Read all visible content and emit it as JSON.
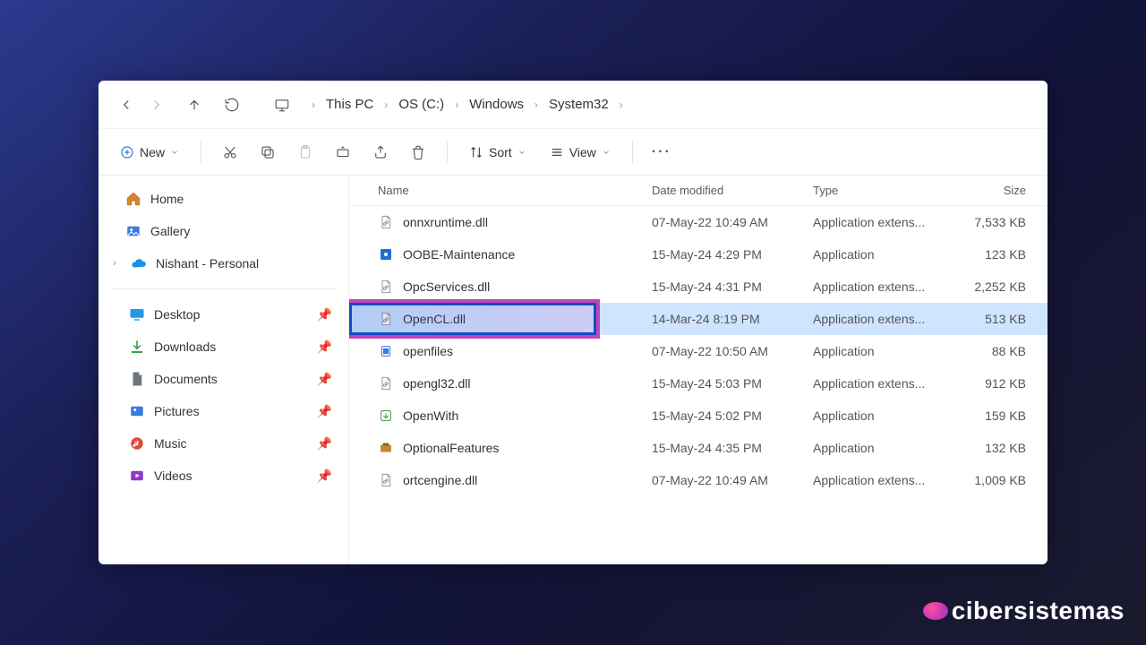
{
  "breadcrumbs": [
    "This PC",
    "OS (C:)",
    "Windows",
    "System32"
  ],
  "toolbar": {
    "new_label": "New",
    "sort_label": "Sort",
    "view_label": "View"
  },
  "columns": {
    "name": "Name",
    "date": "Date modified",
    "type": "Type",
    "size": "Size"
  },
  "side": {
    "home": "Home",
    "gallery": "Gallery",
    "cloud": "Nishant - Personal",
    "desktop": "Desktop",
    "downloads": "Downloads",
    "documents": "Documents",
    "pictures": "Pictures",
    "music": "Music",
    "videos": "Videos"
  },
  "files": [
    {
      "icon": "dll",
      "name": "onnxruntime.dll",
      "date": "07-May-22 10:49 AM",
      "type": "Application extens...",
      "size": "7,533 KB",
      "sel": false
    },
    {
      "icon": "app-gear",
      "name": "OOBE-Maintenance",
      "date": "15-May-24 4:29 PM",
      "type": "Application",
      "size": "123 KB",
      "sel": false
    },
    {
      "icon": "dll",
      "name": "OpcServices.dll",
      "date": "15-May-24 4:31 PM",
      "type": "Application extens...",
      "size": "2,252 KB",
      "sel": false
    },
    {
      "icon": "dll",
      "name": "OpenCL.dll",
      "date": "14-Mar-24 8:19 PM",
      "type": "Application extens...",
      "size": "513 KB",
      "sel": true,
      "highlight": true
    },
    {
      "icon": "app",
      "name": "openfiles",
      "date": "07-May-22 10:50 AM",
      "type": "Application",
      "size": "88 KB",
      "sel": false
    },
    {
      "icon": "dll",
      "name": "opengl32.dll",
      "date": "15-May-24 5:03 PM",
      "type": "Application extens...",
      "size": "912 KB",
      "sel": false
    },
    {
      "icon": "app-arrow",
      "name": "OpenWith",
      "date": "15-May-24 5:02 PM",
      "type": "Application",
      "size": "159 KB",
      "sel": false
    },
    {
      "icon": "app-feat",
      "name": "OptionalFeatures",
      "date": "15-May-24 4:35 PM",
      "type": "Application",
      "size": "132 KB",
      "sel": false
    },
    {
      "icon": "dll",
      "name": "ortcengine.dll",
      "date": "07-May-22 10:49 AM",
      "type": "Application extens...",
      "size": "1,009 KB",
      "sel": false
    }
  ],
  "watermark": "cibersistemas"
}
